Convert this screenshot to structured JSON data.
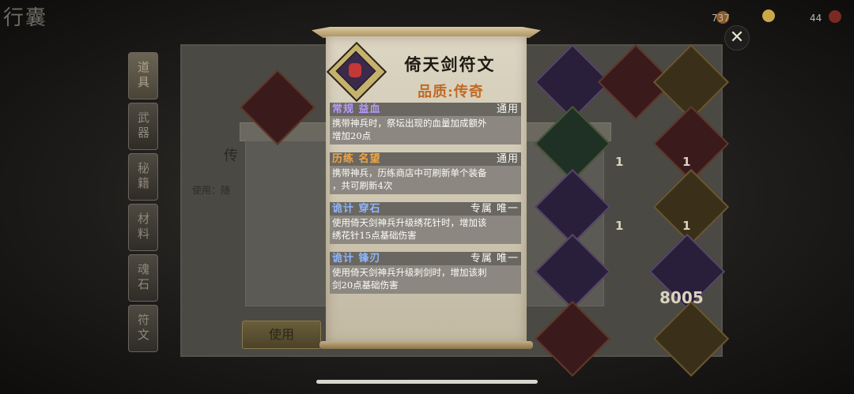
{
  "hud": {
    "logo_text": "行囊",
    "res_1_value": "737",
    "res_2_value": "44",
    "close_icon": "close-icon"
  },
  "tabs": [
    {
      "label": "道具",
      "active": true
    },
    {
      "label": "武器",
      "active": false
    },
    {
      "label": "秘籍",
      "active": false
    },
    {
      "label": "材料",
      "active": false
    },
    {
      "label": "魂石",
      "active": false
    },
    {
      "label": "符文",
      "active": false
    }
  ],
  "back_panel": {
    "title": "传",
    "use_prefix": "使用：随",
    "use_button": "使用"
  },
  "tiles": [
    {
      "count": "1"
    },
    {
      "count": "1"
    },
    {
      "count": "1"
    },
    {
      "count": "1"
    },
    {
      "count": "8005"
    }
  ],
  "item": {
    "name": "倚天剑符文",
    "quality": "品质:传奇",
    "icon": "sword-rune-icon",
    "colors": {
      "quality": "#c06a23",
      "parchment": "#dcd5c2"
    }
  },
  "attributes": [
    {
      "name": "常规 益血",
      "type": "通用",
      "desc_1": "携带神兵时，祭坛出现的血量加成额外",
      "desc_2": "增加20点",
      "color": "purple"
    },
    {
      "name": "历练 名望",
      "type": "通用",
      "desc_1": "携带神兵，历练商店中可刷新单个装备",
      "desc_2": "，共可刷新4次",
      "color": "orange"
    },
    {
      "name": "诡计 穿石",
      "type": "专属 唯一",
      "desc_1": "使用倚天剑神兵升级绣花针时，增加该",
      "desc_2": "绣花针15点基础伤害",
      "color": "blue"
    },
    {
      "name": "诡计 锋刃",
      "type": "专属 唯一",
      "desc_1": "使用倚天剑神兵升级刺剑时，增加该刺",
      "desc_2": "剑20点基础伤害",
      "color": "blue"
    }
  ]
}
